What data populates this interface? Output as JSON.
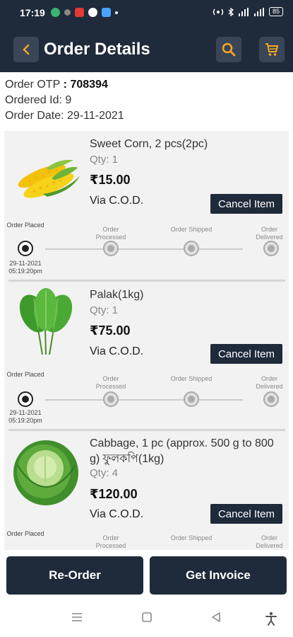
{
  "status": {
    "time": "17:19",
    "battery": "85"
  },
  "header": {
    "title": "Order Details"
  },
  "order": {
    "otp_label": "Order OTP",
    "otp_sep": " : ",
    "otp_value": "708394",
    "id_label": "Ordered Id: 9",
    "date_label": "Order Date: 29-11-2021"
  },
  "steps": [
    "Order Placed",
    "Order Processed",
    "Order Shipped",
    "Order Delivered"
  ],
  "items": [
    {
      "name": "Sweet Corn, 2 pcs(2pc)",
      "qty": "Qty: 1",
      "price": "₹15.00",
      "payment": "Via C.O.D.",
      "cancel_label": "Cancel Item",
      "placed_date": "29-11-2021",
      "placed_time": "05:19:20pm"
    },
    {
      "name": "Palak(1kg)",
      "qty": "Qty: 1",
      "price": "₹75.00",
      "payment": "Via C.O.D.",
      "cancel_label": "Cancel Item",
      "placed_date": "29-11-2021",
      "placed_time": "05:19:20pm"
    },
    {
      "name": "Cabbage, 1 pc (approx. 500 g to 800 g) ফুলকপি(1kg)",
      "qty": "Qty: 4",
      "price": "₹120.00",
      "payment": "Via C.O.D.",
      "cancel_label": "Cancel Item"
    }
  ],
  "actions": {
    "reorder_label": "Re-Order",
    "invoice_label": "Get Invoice"
  },
  "icons": {
    "back": "chevron-left-icon",
    "search": "search-icon",
    "cart": "cart-icon",
    "nav_menu": "menu-icon",
    "nav_home": "square-icon",
    "nav_back": "triangle-back-icon",
    "nav_accessibility": "accessibility-icon"
  },
  "colors": {
    "primary": "#1f2a3a",
    "accent": "#f5a623"
  }
}
